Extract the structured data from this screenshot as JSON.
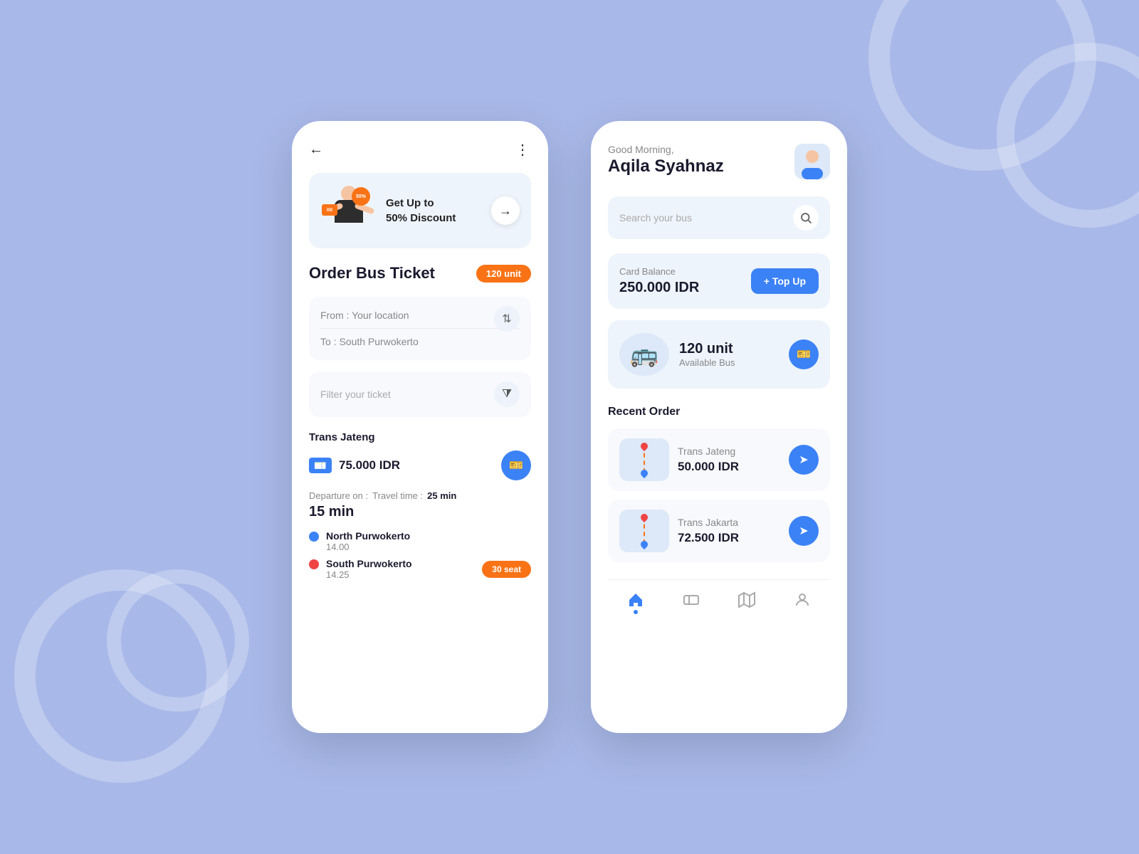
{
  "background": {
    "color": "#a8b8e8"
  },
  "left_phone": {
    "header": {
      "back_label": "←",
      "more_label": "⋮"
    },
    "banner": {
      "text": "Get Up to\n50% Discount",
      "discount_pct": "50%",
      "arrow_label": "→"
    },
    "title": "Order Bus Ticket",
    "unit_badge": "120 unit",
    "from_placeholder": "From : Your location",
    "to_placeholder": "To : South Purwokerto",
    "filter_placeholder": "Filter your ticket",
    "ticket": {
      "operator": "Trans Jateng",
      "price": "75.000 IDR",
      "departure_label": "Departure on :",
      "travel_label": "Travel time :",
      "travel_time": "25 min",
      "wait_time": "15 min",
      "stop_from": "North Purwokerto",
      "stop_from_time": "14.00",
      "stop_to": "South Purwokerto",
      "stop_to_time": "14.25",
      "seat_badge": "30 seat"
    }
  },
  "right_phone": {
    "greeting": "Good Morning,",
    "user_name": "Aqila Syahnaz",
    "search_placeholder": "Search your bus",
    "balance": {
      "label": "Card Balance",
      "amount": "250.000 IDR",
      "topup_label": "+ Top Up"
    },
    "bus_info": {
      "count": "120 unit",
      "label": "Available Bus"
    },
    "recent_label": "Recent Order",
    "orders": [
      {
        "operator": "Trans Jateng",
        "price": "50.000 IDR"
      },
      {
        "operator": "Trans Jakarta",
        "price": "72.500 IDR"
      }
    ],
    "nav": {
      "home": "🏠",
      "ticket": "🎫",
      "map": "🗺",
      "profile": "👤"
    }
  }
}
